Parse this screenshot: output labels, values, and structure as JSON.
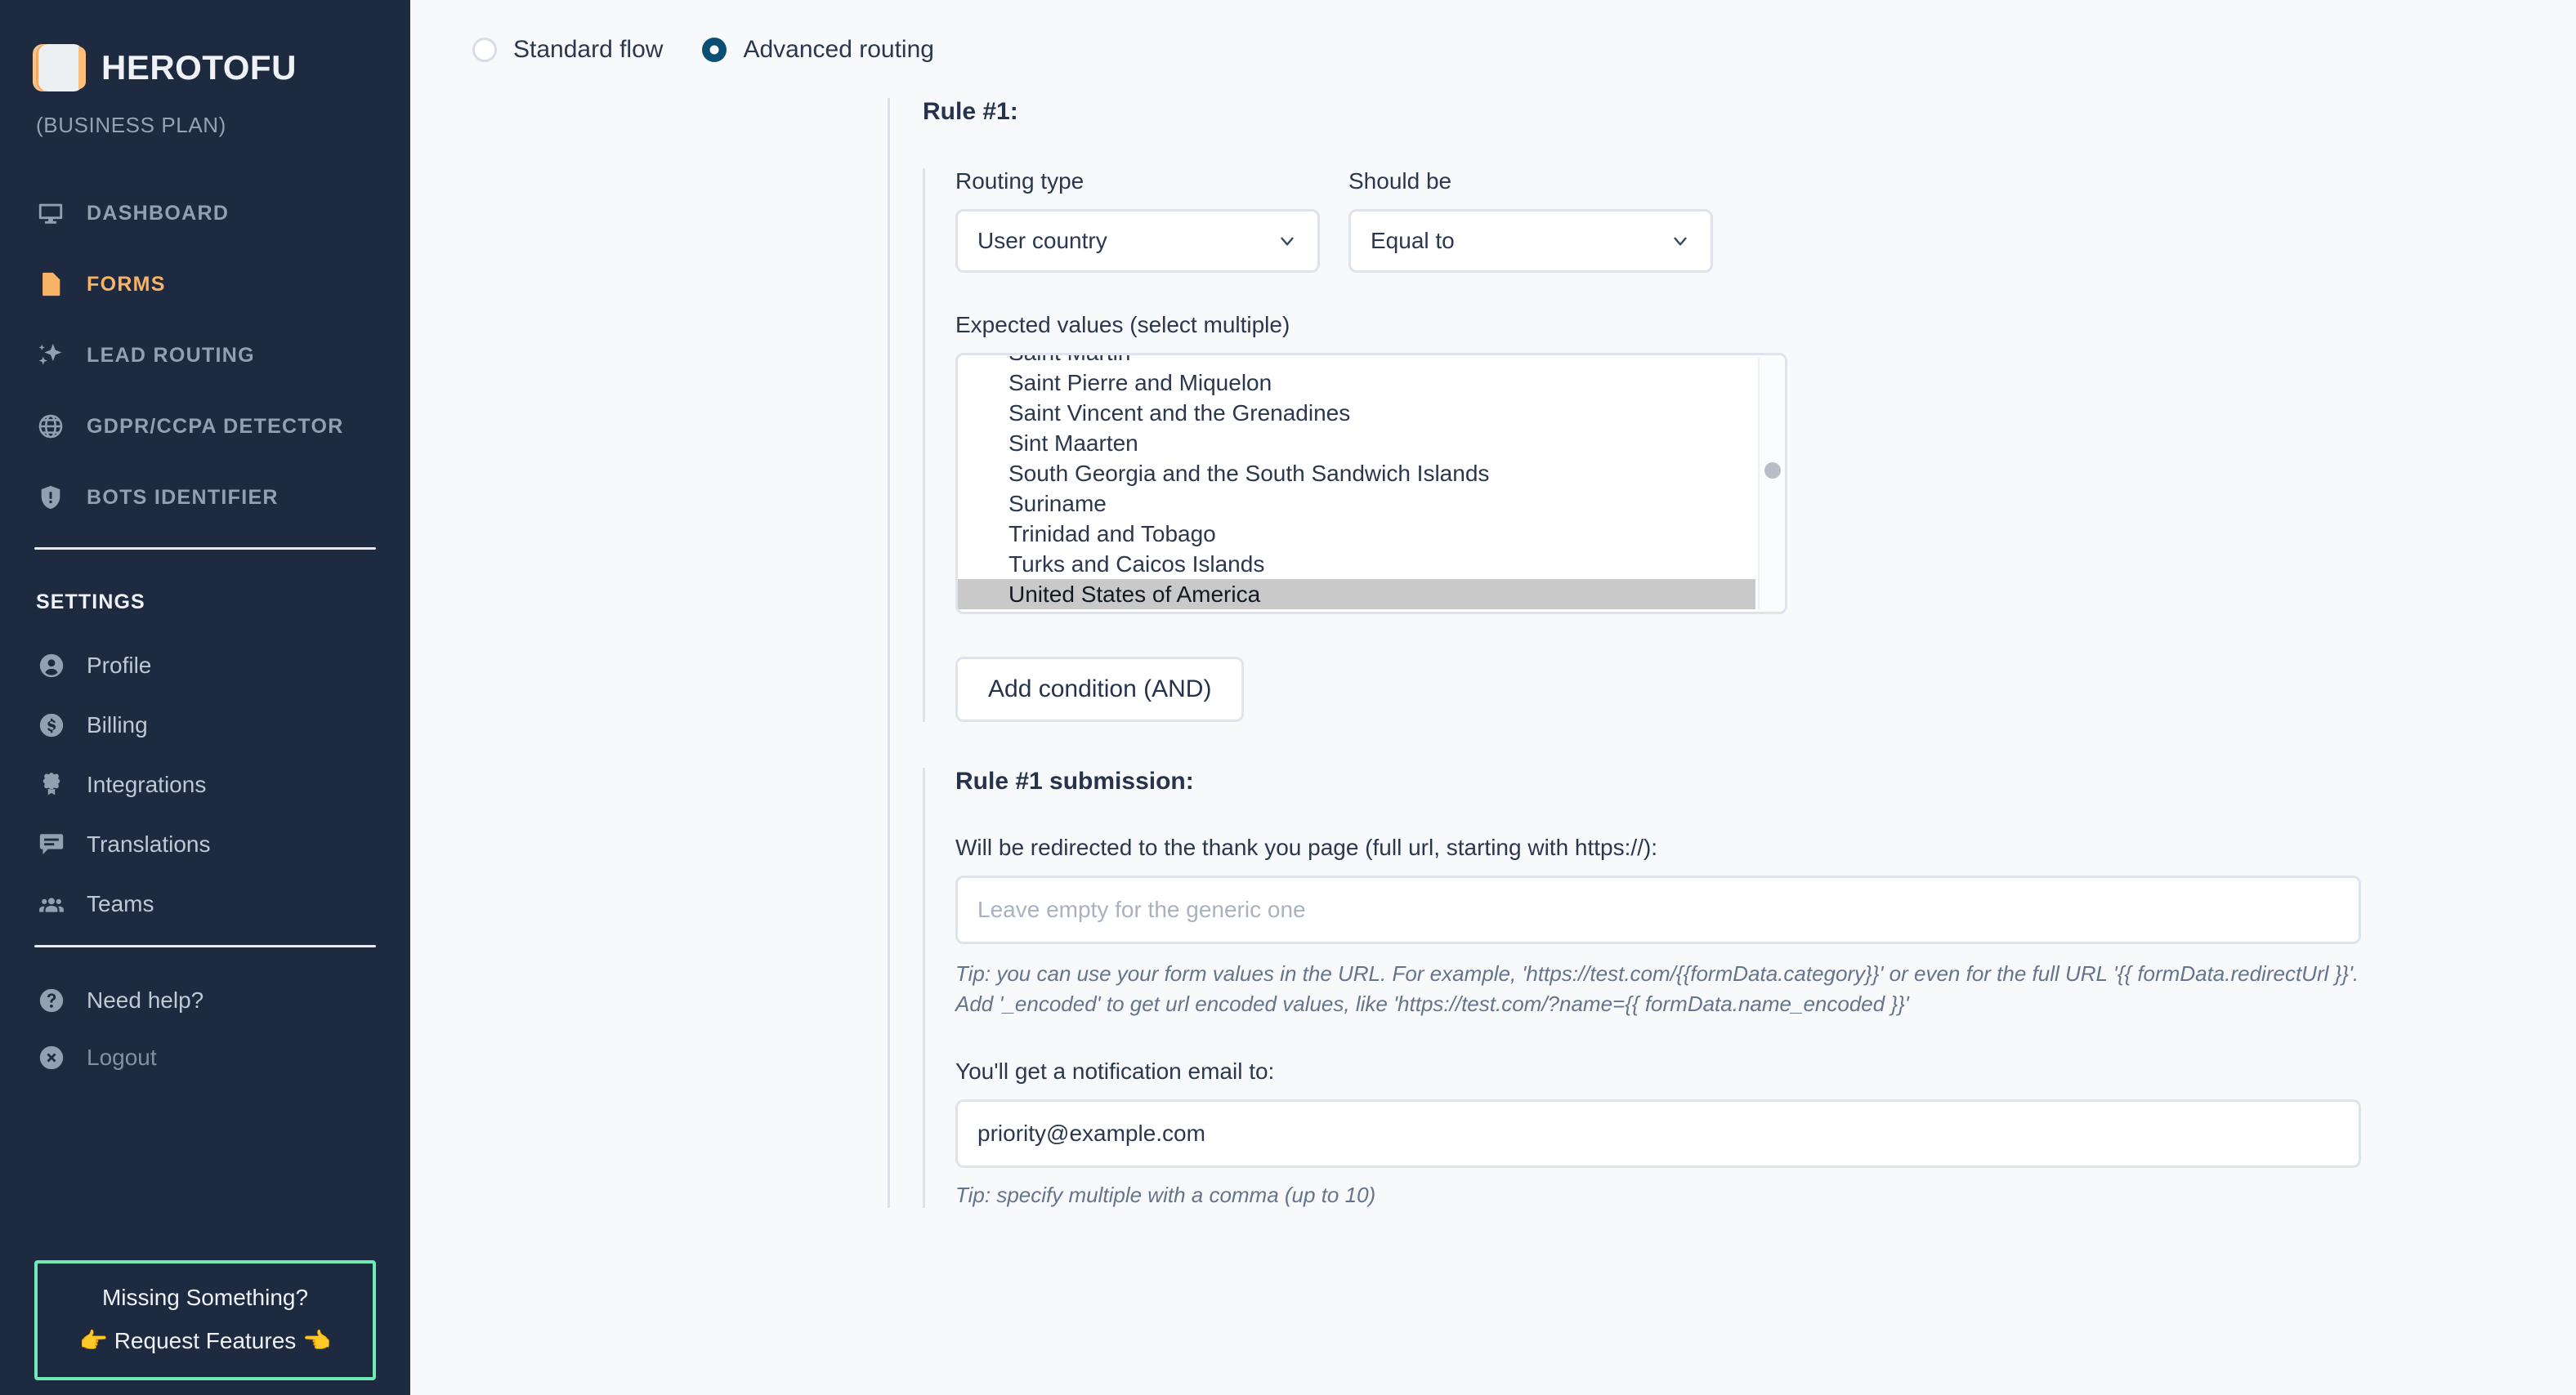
{
  "sidebar": {
    "brand_name": "HEROTOFU",
    "plan": "(BUSINESS PLAN)",
    "nav": [
      {
        "label": "DASHBOARD",
        "icon": "monitor-icon",
        "active": false
      },
      {
        "label": "FORMS",
        "icon": "document-icon",
        "active": true
      },
      {
        "label": "LEAD ROUTING",
        "icon": "sparkles-icon",
        "active": false
      },
      {
        "label": "GDPR/CCPA DETECTOR",
        "icon": "globe-icon",
        "active": false
      },
      {
        "label": "BOTS IDENTIFIER",
        "icon": "shield-alert-icon",
        "active": false
      }
    ],
    "settings_title": "SETTINGS",
    "settings": [
      {
        "label": "Profile",
        "icon": "user-circle-icon"
      },
      {
        "label": "Billing",
        "icon": "dollar-circle-icon"
      },
      {
        "label": "Integrations",
        "icon": "puzzle-icon"
      },
      {
        "label": "Translations",
        "icon": "chat-icon"
      },
      {
        "label": "Teams",
        "icon": "people-icon"
      }
    ],
    "footer": [
      {
        "label": "Need help?",
        "icon": "question-circle-icon"
      },
      {
        "label": "Logout",
        "icon": "close-circle-icon"
      }
    ],
    "promo": {
      "title": "Missing Something?",
      "cta": "👉 Request Features 👈"
    },
    "accent_active": "#f9b368",
    "accent_promo_border": "#6fe9b6",
    "background": "#1e2a40"
  },
  "main": {
    "flow_modes": [
      {
        "label": "Standard flow",
        "selected": false
      },
      {
        "label": "Advanced routing",
        "selected": true
      }
    ],
    "rule": {
      "title": "Rule #1:",
      "routing_type_label": "Routing type",
      "routing_type_value": "User country",
      "should_be_label": "Should be",
      "should_be_value": "Equal to",
      "expected_values_label": "Expected values (select multiple)",
      "expected_values_options": [
        {
          "label": "Saint Martin",
          "selected": false,
          "clipped": true
        },
        {
          "label": "Saint Pierre and Miquelon",
          "selected": false
        },
        {
          "label": "Saint Vincent and the Grenadines",
          "selected": false
        },
        {
          "label": "Sint Maarten",
          "selected": false
        },
        {
          "label": "South Georgia and the South Sandwich Islands",
          "selected": false
        },
        {
          "label": "Suriname",
          "selected": false
        },
        {
          "label": "Trinidad and Tobago",
          "selected": false
        },
        {
          "label": "Turks and Caicos Islands",
          "selected": false
        },
        {
          "label": "United States of America",
          "selected": true
        }
      ],
      "add_condition_label": "Add condition (AND)"
    },
    "submission": {
      "title": "Rule #1 submission:",
      "redirect_label": "Will be redirected to the thank you page (full url, starting with https://):",
      "redirect_placeholder": "Leave empty for the generic one",
      "redirect_value": "",
      "redirect_tip": "Tip: you can use your form values in the URL. For example, 'https://test.com/{{formData.category}}' or even for the full URL '{{ formData.redirectUrl }}'. Add '_encoded' to get url encoded values, like 'https://test.com/?name={{ formData.name_encoded }}'",
      "email_label": "You'll get a notification email to:",
      "email_value": "priority@example.com",
      "email_placeholder": "",
      "email_tip": "Tip: specify multiple with a comma (up to 10)"
    },
    "selection_highlight_color": "#c9c9c9",
    "radio_selected_color": "#0d4f72",
    "background": "#f7f9fb"
  }
}
